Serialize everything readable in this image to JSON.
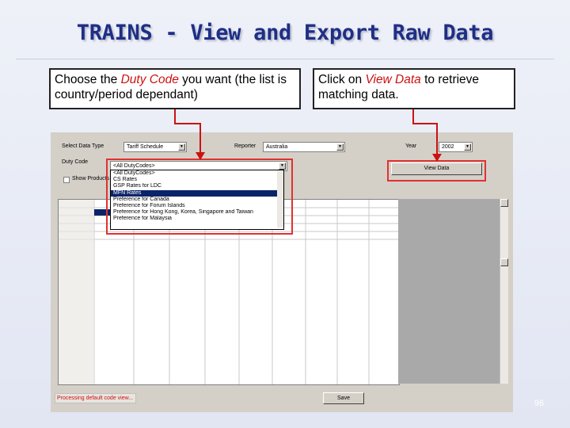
{
  "slide": {
    "title": "TRAINS - View and Export Raw Data",
    "page_number": "96",
    "callout_left": {
      "part1": "Choose the ",
      "highlight": "Duty Code",
      "part2": " you want (the list is country/period dependant)"
    },
    "callout_right": {
      "part1": "Click on ",
      "highlight": "View Data",
      "part2": " to retrieve matching data."
    }
  },
  "app": {
    "select_data_type_label": "Select Data Type",
    "data_type_value": "Tariff Schedule",
    "reporter_label": "Reporter",
    "reporter_value": "Australia",
    "year_label": "Year",
    "year_value": "2002",
    "duty_code_label": "Duty Code",
    "duty_code_value": "<All DutyCodes>",
    "duty_code_options": [
      "<All DutyCodes>",
      "CS Rates",
      "GSP Rates for LDC",
      "MFN Rates",
      "Preference for Canada",
      "Preference for Forum Islands",
      "Preference for Hong Kong, Korea, Singapore and Taiwan",
      "Preference for Malaysia"
    ],
    "selected_option_index": 3,
    "show_products_label": "Show Products",
    "view_data_label": "View Data",
    "save_label": "Save",
    "status_text": "Processing default code view..."
  },
  "colors": {
    "title": "#1f2f86",
    "highlight": "#cc1111",
    "selection": "#0a246a"
  }
}
